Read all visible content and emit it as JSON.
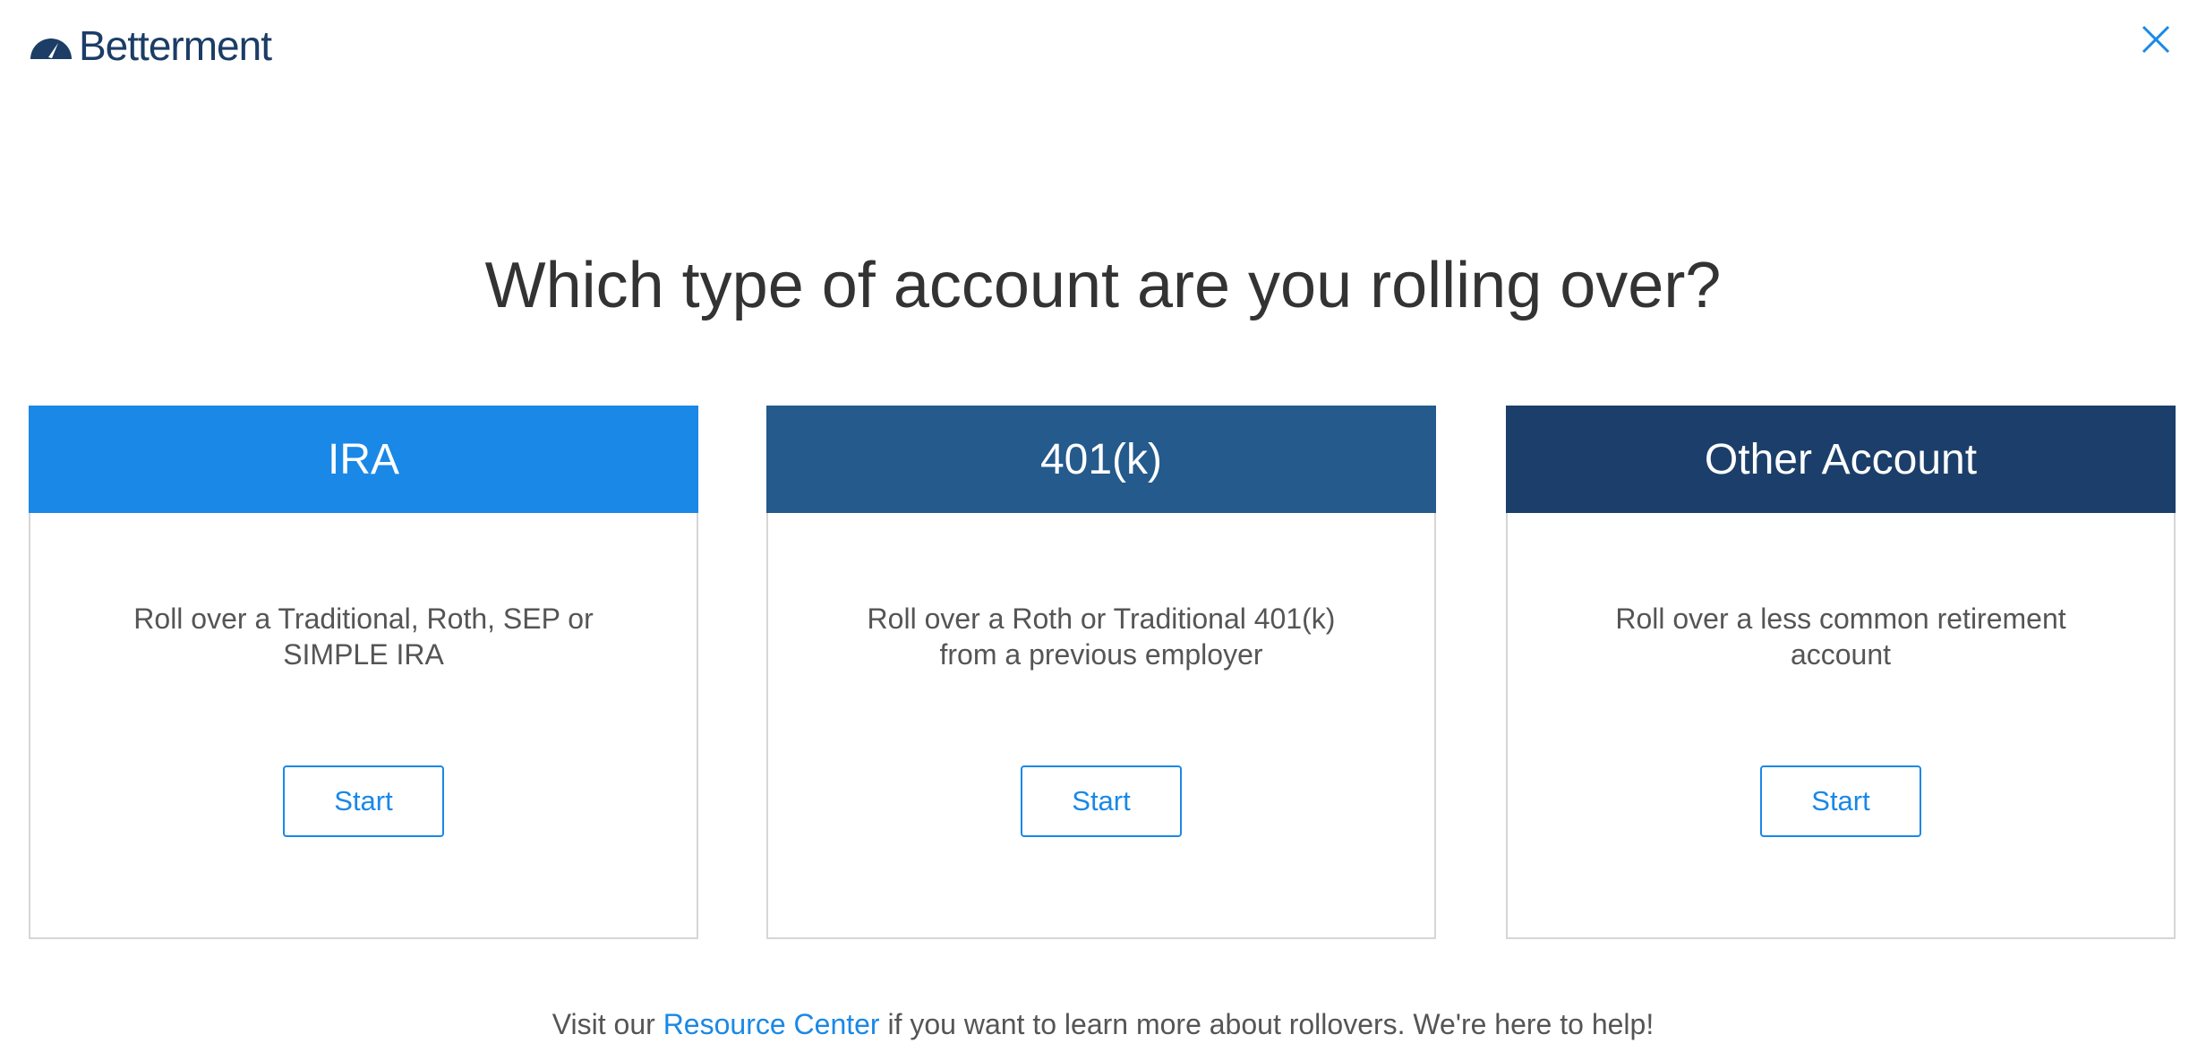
{
  "brand": {
    "name": "Betterment",
    "color": "#1b3d66"
  },
  "header": {
    "close_icon": "close-icon"
  },
  "title": "Which type of account are you rolling over?",
  "cards": [
    {
      "id": "ira",
      "heading": "IRA",
      "description": "Roll over a Traditional, Roth, SEP or SIMPLE IRA",
      "button": "Start",
      "color": "#1a88e6"
    },
    {
      "id": "401k",
      "heading": "401(k)",
      "description": "Roll over a Roth or Traditional 401(k) from a previous employer",
      "button": "Start",
      "color": "#245a8c"
    },
    {
      "id": "other",
      "heading": "Other Account",
      "description": "Roll over a less common retirement account",
      "button": "Start",
      "color": "#1b3f6a"
    }
  ],
  "footer": {
    "prefix": "Visit our ",
    "link": "Resource Center",
    "suffix": " if you want to learn more about rollovers. We're here to help!"
  },
  "accent_color": "#1a88e6"
}
